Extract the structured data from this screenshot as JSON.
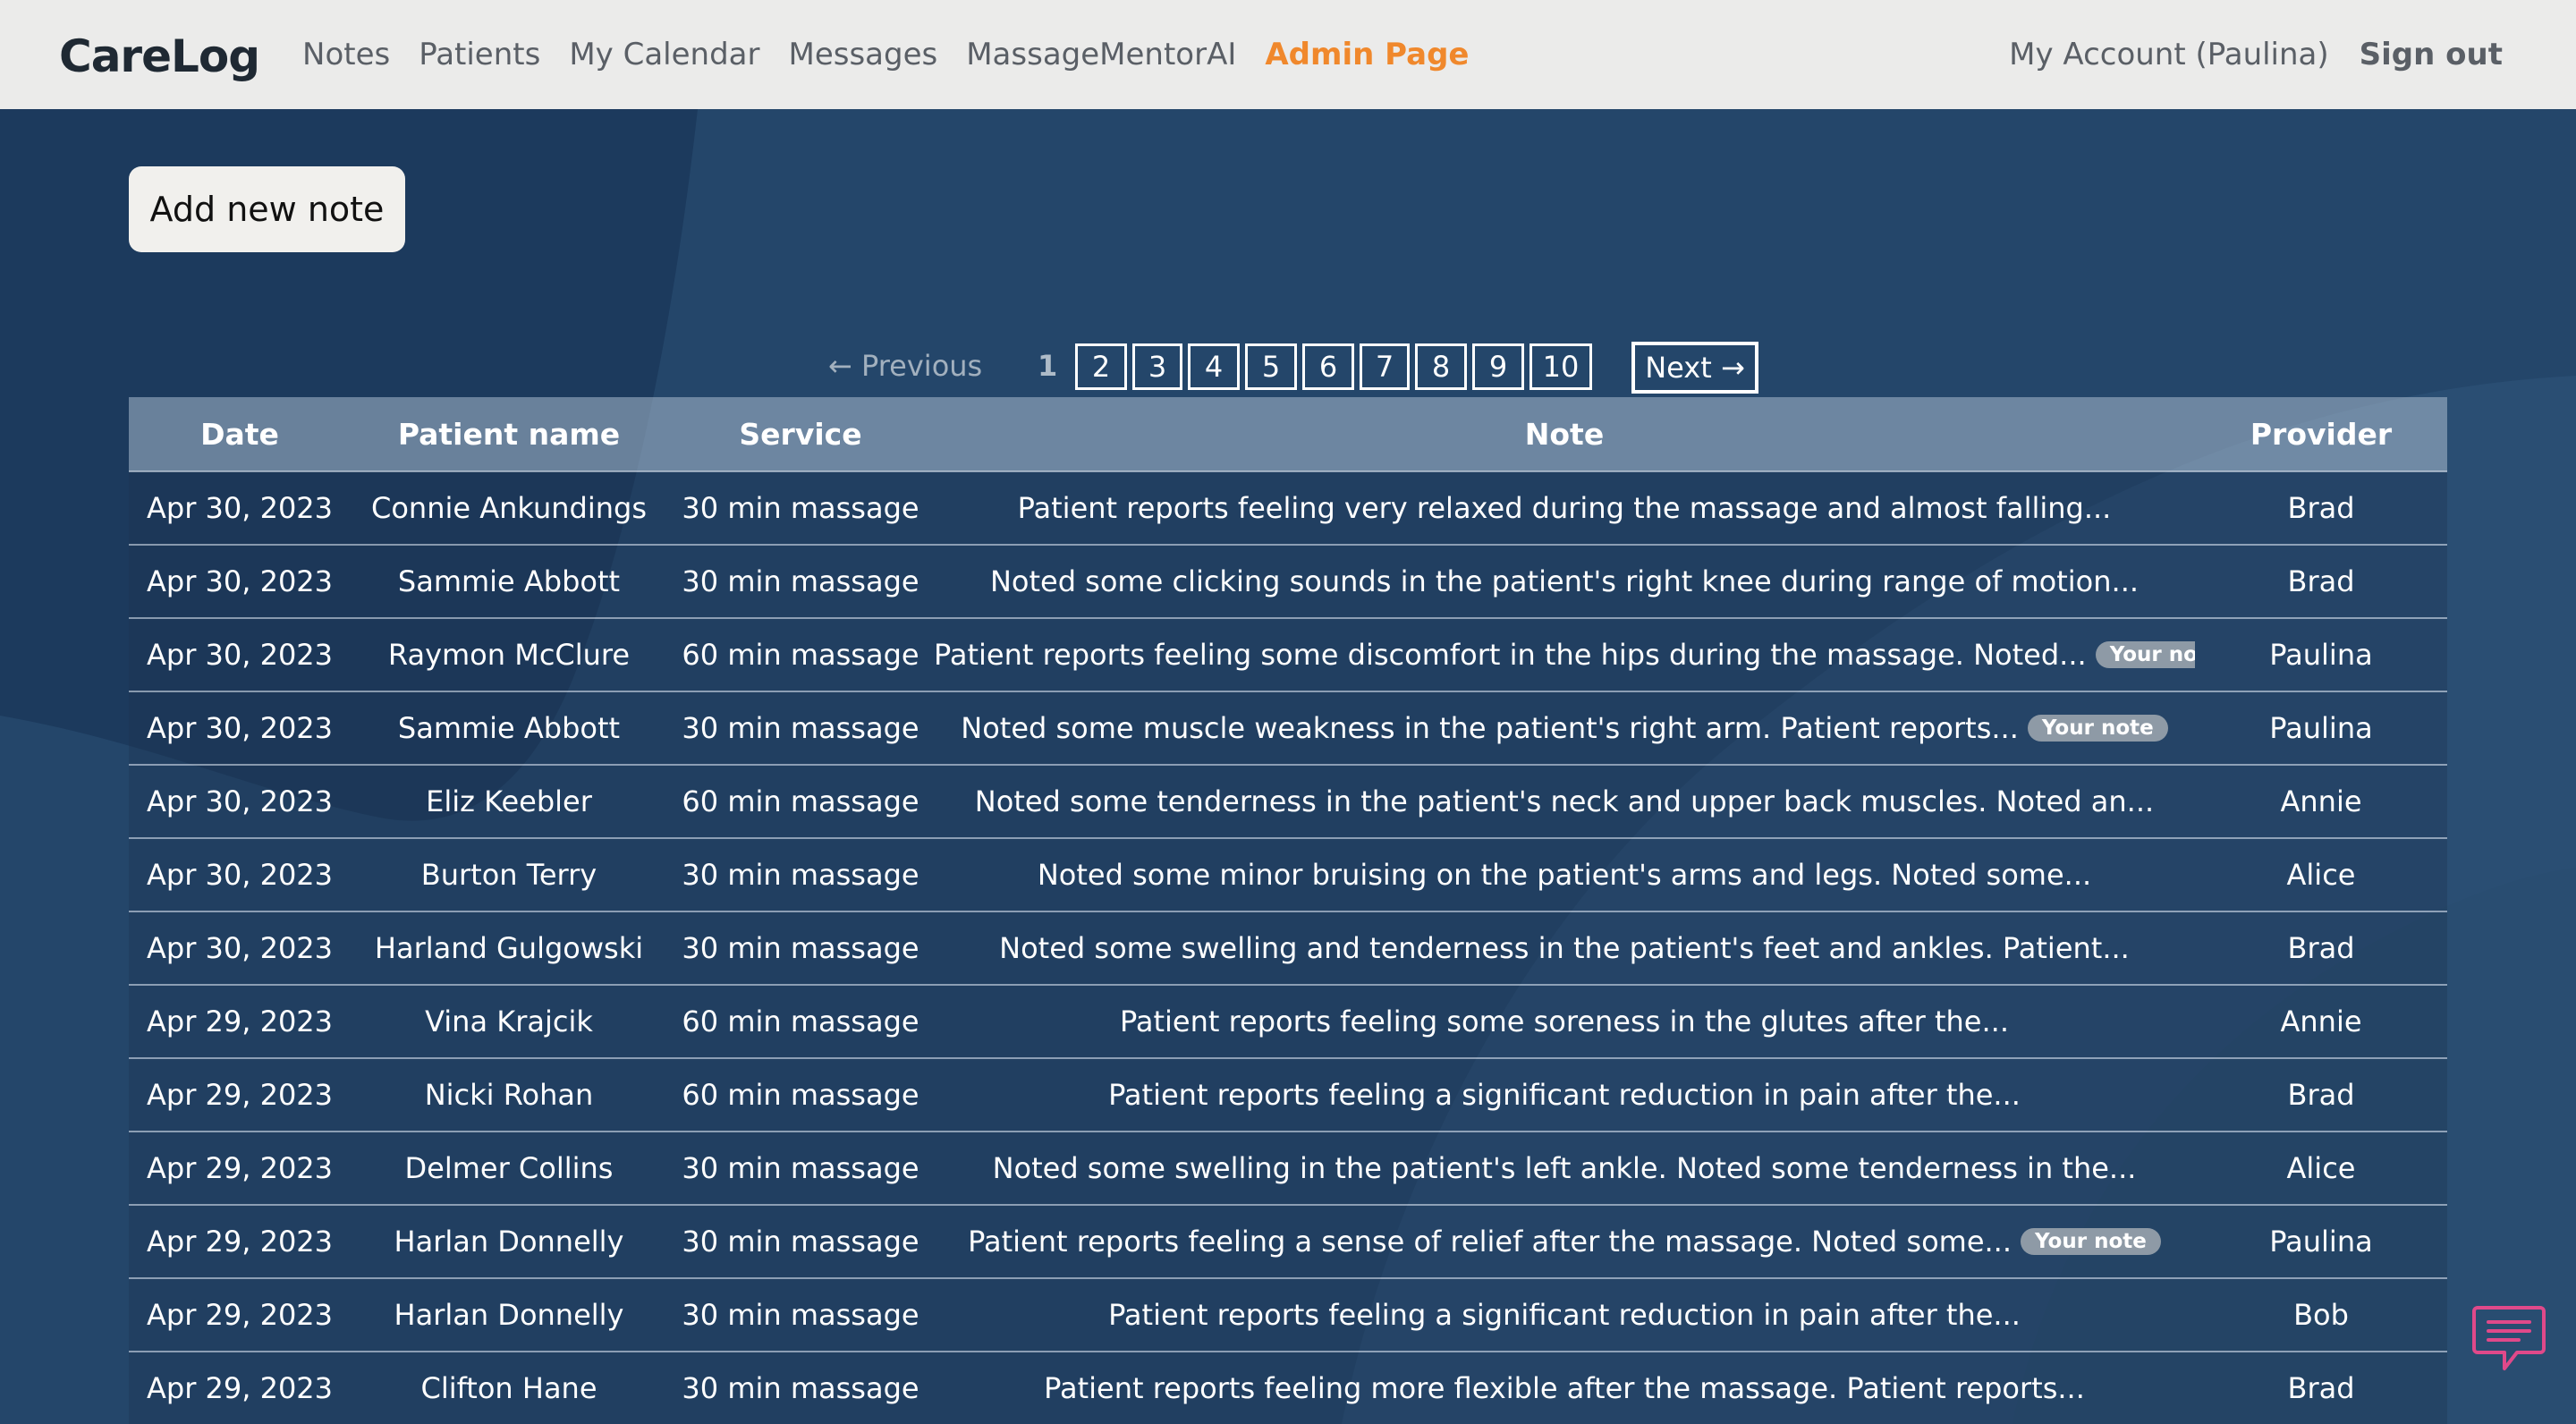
{
  "nav": {
    "brand": "CareLog",
    "links": [
      "Notes",
      "Patients",
      "My Calendar",
      "Messages",
      "MassageMentorAI",
      "Admin Page"
    ],
    "account": "My Account (Paulina)",
    "signout": "Sign out",
    "active_color": "#f0882c"
  },
  "actions": {
    "add_note": "Add new note"
  },
  "pagination": {
    "previous": "← Previous",
    "current": "1",
    "pages": [
      "2",
      "3",
      "4",
      "5",
      "6",
      "7",
      "8",
      "9",
      "10"
    ],
    "next": "Next →"
  },
  "table": {
    "headers": [
      "Date",
      "Patient name",
      "Service",
      "Note",
      "Provider"
    ],
    "badge_label": "Your note",
    "rows": [
      {
        "date": "Apr 30, 2023",
        "patient": "Connie Ankundings",
        "service": "30 min massage",
        "note": "Patient reports feeling very relaxed during the massage and almost falling...",
        "provider": "Brad",
        "own": false
      },
      {
        "date": "Apr 30, 2023",
        "patient": "Sammie Abbott",
        "service": "30 min massage",
        "note": "Noted some clicking sounds in the patient's right knee during range of motion...",
        "provider": "Brad",
        "own": false
      },
      {
        "date": "Apr 30, 2023",
        "patient": "Raymon McClure",
        "service": "60 min massage",
        "note": "Patient reports feeling some discomfort in the hips during the massage. Noted...",
        "provider": "Paulina",
        "own": true
      },
      {
        "date": "Apr 30, 2023",
        "patient": "Sammie Abbott",
        "service": "30 min massage",
        "note": "Noted some muscle weakness in the patient's right arm. Patient reports...",
        "provider": "Paulina",
        "own": true
      },
      {
        "date": "Apr 30, 2023",
        "patient": "Eliz Keebler",
        "service": "60 min massage",
        "note": "Noted some tenderness in the patient's neck and upper back muscles. Noted an...",
        "provider": "Annie",
        "own": false
      },
      {
        "date": "Apr 30, 2023",
        "patient": "Burton Terry",
        "service": "30 min massage",
        "note": "Noted some minor bruising on the patient's arms and legs. Noted some...",
        "provider": "Alice",
        "own": false
      },
      {
        "date": "Apr 30, 2023",
        "patient": "Harland Gulgowski",
        "service": "30 min massage",
        "note": "Noted some swelling and tenderness in the patient's feet and ankles. Patient...",
        "provider": "Brad",
        "own": false
      },
      {
        "date": "Apr 29, 2023",
        "patient": "Vina Krajcik",
        "service": "60 min massage",
        "note": "Patient reports feeling some soreness in the glutes after the...",
        "provider": "Annie",
        "own": false
      },
      {
        "date": "Apr 29, 2023",
        "patient": "Nicki Rohan",
        "service": "60 min massage",
        "note": "Patient reports feeling a significant reduction in pain after the...",
        "provider": "Brad",
        "own": false
      },
      {
        "date": "Apr 29, 2023",
        "patient": "Delmer Collins",
        "service": "30 min massage",
        "note": "Noted some swelling in the patient's left ankle. Noted some tenderness in the...",
        "provider": "Alice",
        "own": false
      },
      {
        "date": "Apr 29, 2023",
        "patient": "Harlan Donnelly",
        "service": "30 min massage",
        "note": "Patient reports feeling a sense of relief after the massage. Noted some...",
        "provider": "Paulina",
        "own": true
      },
      {
        "date": "Apr 29, 2023",
        "patient": "Harlan Donnelly",
        "service": "30 min massage",
        "note": "Patient reports feeling a significant reduction in pain after the...",
        "provider": "Bob",
        "own": false
      },
      {
        "date": "Apr 29, 2023",
        "patient": "Clifton Hane",
        "service": "30 min massage",
        "note": "Patient reports feeling more flexible after the massage. Patient reports...",
        "provider": "Brad",
        "own": false
      }
    ]
  },
  "chat": {
    "icon": "chat-bubble-icon",
    "color": "#e0498a"
  }
}
